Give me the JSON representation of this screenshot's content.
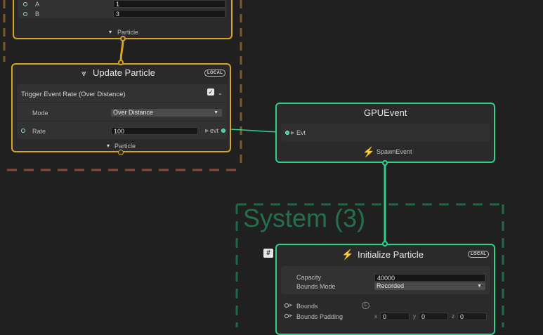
{
  "colors": {
    "canvas_bg": "#202020",
    "node_bg": "#2a2a2a",
    "particle_flow": "#d9a520",
    "event_flow": "#2fd08a",
    "system_frame_red": "#8a4a38",
    "system_frame_orange": "#7a5a2a",
    "system_frame_green": "#1e6a46",
    "system_title_green": "#24704c"
  },
  "top_node": {
    "attr_a_label": "A",
    "attr_a_value": "1",
    "attr_b_label": "B",
    "attr_b_value": "3",
    "output_label": "Particle",
    "output_icon": "particle-icon"
  },
  "update_node": {
    "title": "Update Particle",
    "badge": "LOCAL",
    "input_label": "Particle",
    "block": {
      "title": "Trigger Event Rate (Over Distance)",
      "mode_label": "Mode",
      "mode_value": "Over Distance",
      "rate_label": "Rate",
      "rate_value": "100",
      "evt_label": "evt"
    }
  },
  "gpu_event_node": {
    "title": "GPUEvent",
    "input_label": "Evt",
    "output_label": "SpawnEvent",
    "output_icon": "lightning-icon"
  },
  "system": {
    "title": "System (3)"
  },
  "initialize_node": {
    "title": "Initialize Particle",
    "badge": "LOCAL",
    "icon": "lightning-icon",
    "capacity_label": "Capacity",
    "capacity_value": "40000",
    "bounds_mode_label": "Bounds Mode",
    "bounds_mode_value": "Recorded",
    "bounds_label": "Bounds",
    "bounds_space_badge": "L",
    "bounds_padding_label": "Bounds Padding",
    "padding_x_label": "x",
    "padding_x_value": "0",
    "padding_y_label": "y",
    "padding_y_value": "0",
    "padding_z_label": "z",
    "padding_z_value": "0"
  },
  "hash_badge": "#"
}
